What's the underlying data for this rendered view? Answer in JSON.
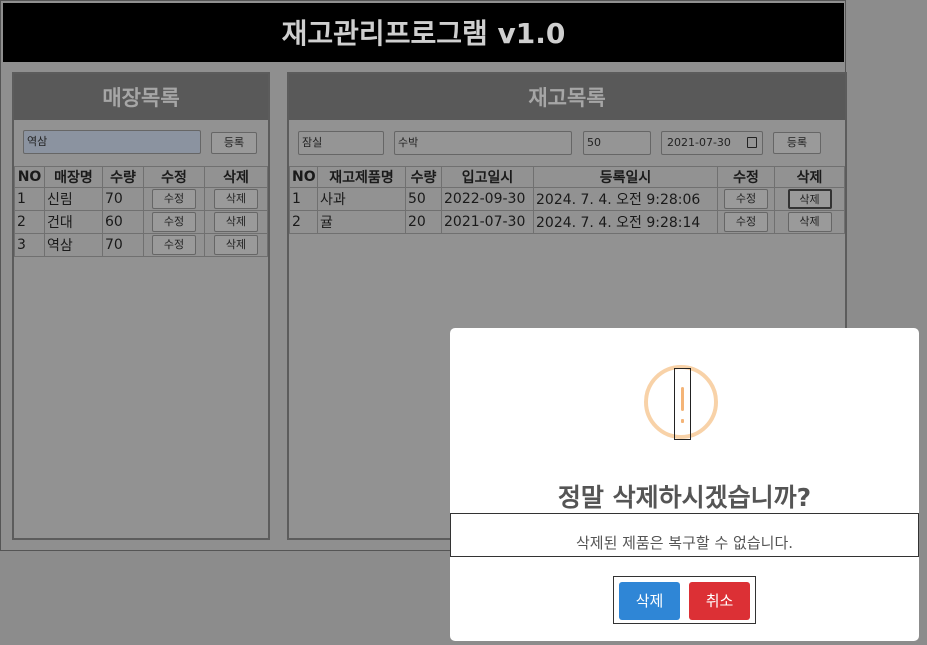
{
  "app": {
    "title": "재고관리프로그램 v1.0"
  },
  "store_panel": {
    "title": "매장목록",
    "input_value": "역삼",
    "register_label": "등록",
    "columns": [
      "NO",
      "매장명",
      "수량",
      "수정",
      "삭제"
    ],
    "rows": [
      {
        "no": "1",
        "name": "신림",
        "qty": "70",
        "edit": "수정",
        "del": "삭제"
      },
      {
        "no": "2",
        "name": "건대",
        "qty": "60",
        "edit": "수정",
        "del": "삭제"
      },
      {
        "no": "3",
        "name": "역삼",
        "qty": "70",
        "edit": "수정",
        "del": "삭제"
      }
    ]
  },
  "stock_panel": {
    "title": "재고목록",
    "store_value": "잠실",
    "product_value": "수박",
    "qty_value": "50",
    "date_value": "2021-07-30",
    "register_label": "등록",
    "columns": [
      "NO",
      "재고제품명",
      "수량",
      "입고일시",
      "등록일시",
      "수정",
      "삭제"
    ],
    "rows": [
      {
        "no": "1",
        "name": "사과",
        "qty": "50",
        "in_date": "2022-09-30",
        "reg_date": "2024. 7. 4. 오전 9:28:06",
        "edit": "수정",
        "del": "삭제"
      },
      {
        "no": "2",
        "name": "귤",
        "qty": "20",
        "in_date": "2021-07-30",
        "reg_date": "2024. 7. 4. 오전 9:28:14",
        "edit": "수정",
        "del": "삭제"
      }
    ]
  },
  "modal": {
    "icon": "warning-icon",
    "title": "정말 삭제하시겠습니까?",
    "text": "삭제된 제품은 복구할 수 없습니다.",
    "confirm_label": "삭제",
    "cancel_label": "취소",
    "colors": {
      "confirm": "#2f86d6",
      "cancel": "#dc3035",
      "icon": "#f8bb86"
    }
  }
}
